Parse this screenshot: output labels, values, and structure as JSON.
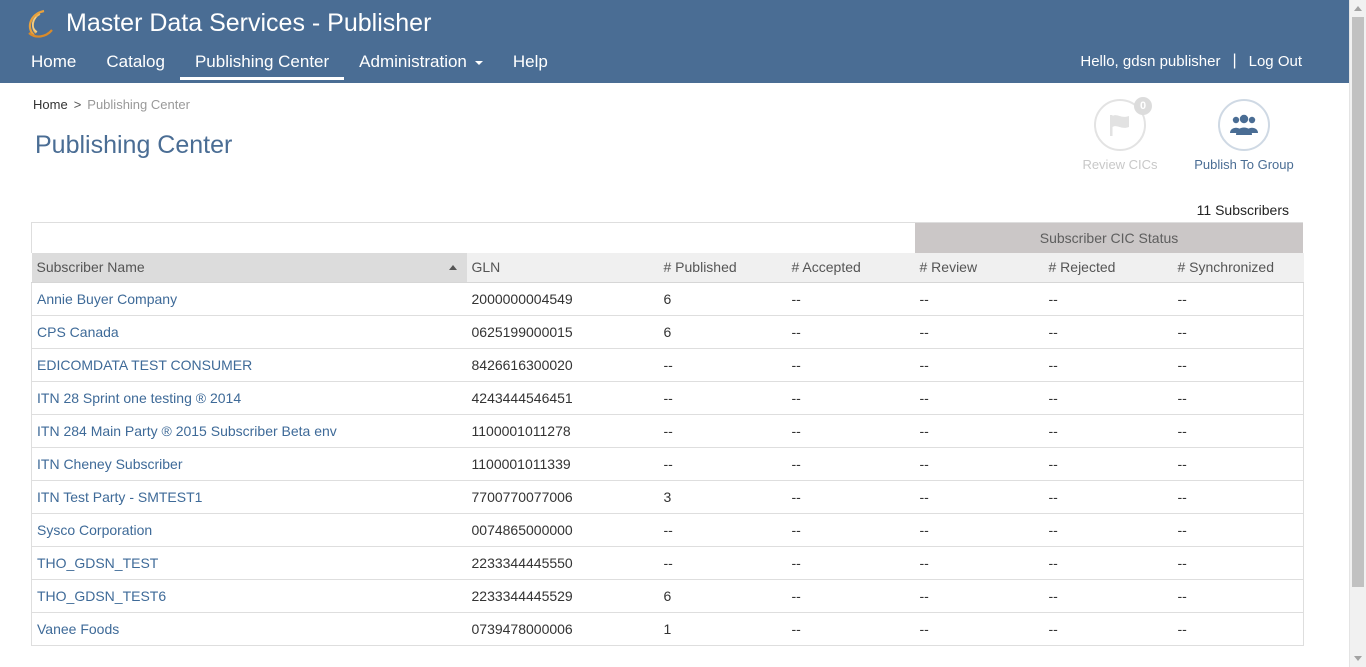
{
  "header": {
    "app_title": "Master Data Services - Publisher",
    "nav": [
      {
        "label": "Home"
      },
      {
        "label": "Catalog"
      },
      {
        "label": "Publishing Center",
        "active": true
      },
      {
        "label": "Administration",
        "dropdown": true
      },
      {
        "label": "Help"
      }
    ],
    "greeting": "Hello, gdsn publisher",
    "separator": "|",
    "logout": "Log Out"
  },
  "breadcrumb": {
    "home": "Home",
    "separator": ">",
    "current": "Publishing Center"
  },
  "page_title": "Publishing Center",
  "actions": {
    "review": {
      "label": "Review CICs",
      "badge": "0",
      "icon": "flag-icon",
      "enabled": false
    },
    "publish": {
      "label": "Publish To Group",
      "icon": "group-icon",
      "enabled": true
    }
  },
  "subscriber_count": "11 Subscribers",
  "table": {
    "group_header": "Subscriber CIC Status",
    "columns": [
      "Subscriber Name",
      "GLN",
      "# Published",
      "# Accepted",
      "# Review",
      "# Rejected",
      "# Synchronized"
    ],
    "rows": [
      [
        "Annie Buyer Company",
        "2000000004549",
        "6",
        "--",
        "--",
        "--",
        "--"
      ],
      [
        "CPS Canada",
        "0625199000015",
        "6",
        "--",
        "--",
        "--",
        "--"
      ],
      [
        "EDICOMDATA TEST CONSUMER",
        "8426616300020",
        "--",
        "--",
        "--",
        "--",
        "--"
      ],
      [
        "ITN 28 Sprint one testing ® 2014",
        "4243444546451",
        "--",
        "--",
        "--",
        "--",
        "--"
      ],
      [
        "ITN 284 Main Party ® 2015 Subscriber Beta env",
        "1100001011278",
        "--",
        "--",
        "--",
        "--",
        "--"
      ],
      [
        "ITN Cheney Subscriber",
        "1100001011339",
        "--",
        "--",
        "--",
        "--",
        "--"
      ],
      [
        "ITN Test Party - SMTEST1",
        "7700770077006",
        "3",
        "--",
        "--",
        "--",
        "--"
      ],
      [
        "Sysco Corporation",
        "0074865000000",
        "--",
        "--",
        "--",
        "--",
        "--"
      ],
      [
        "THO_GDSN_TEST",
        "2233344445550",
        "--",
        "--",
        "--",
        "--",
        "--"
      ],
      [
        "THO_GDSN_TEST6",
        "2233344445529",
        "6",
        "--",
        "--",
        "--",
        "--"
      ],
      [
        "Vanee Foods",
        "0739478000006",
        "1",
        "--",
        "--",
        "--",
        "--"
      ]
    ]
  },
  "colors": {
    "header_bg": "#4a6d94",
    "link": "#3e6a98",
    "group_header_bg": "#cbc7c7"
  }
}
